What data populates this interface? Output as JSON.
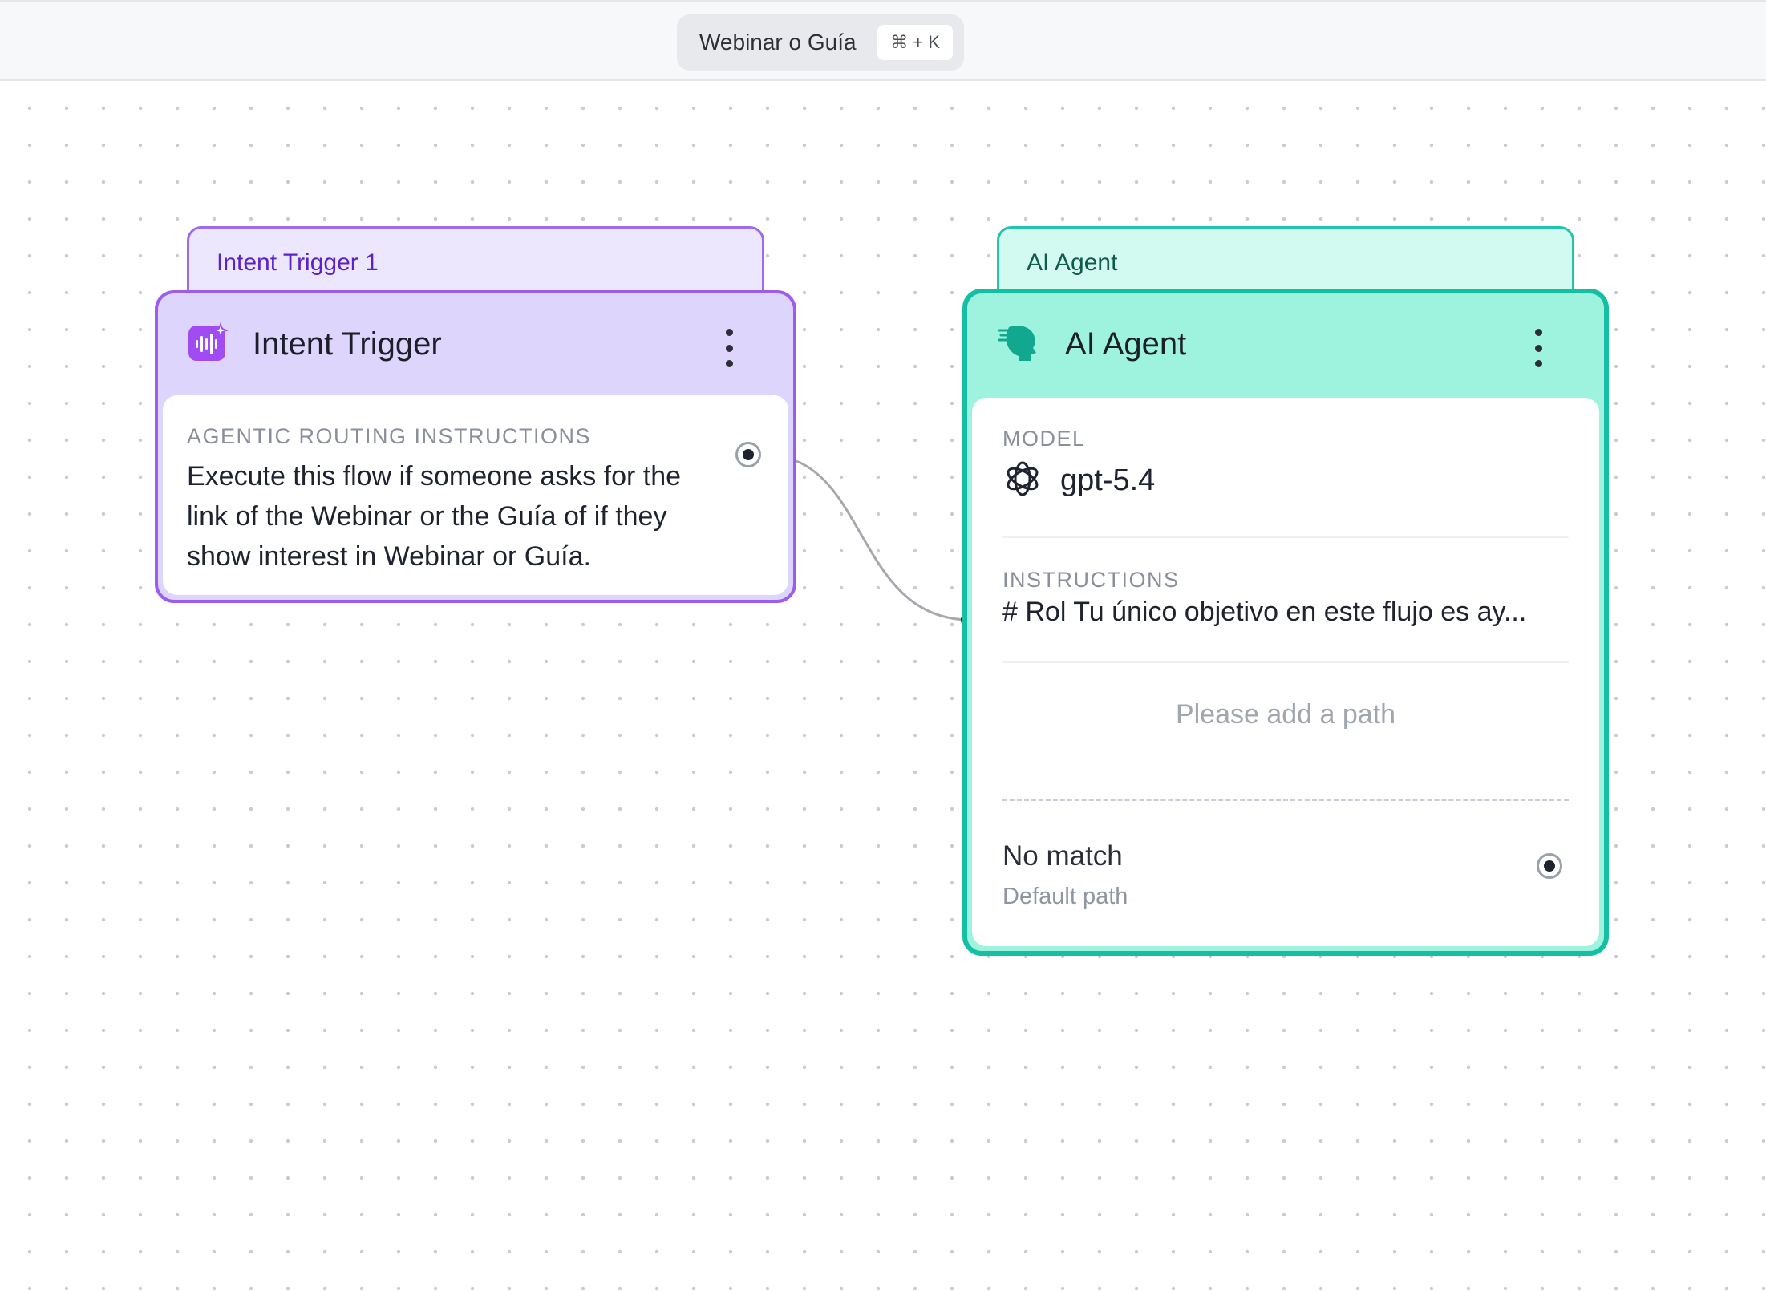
{
  "topbar": {
    "flow_name": "Webinar o Guía",
    "shortcut": "⌘ + K"
  },
  "trigger_node": {
    "tab_label": "Intent Trigger 1",
    "title": "Intent Trigger",
    "icon": "audio-sparkle-icon",
    "section_label": "AGENTIC ROUTING INSTRUCTIONS",
    "instructions": "Execute this flow if someone asks for the link of the Webinar or the Guía of if they show interest in Webinar or Guía.",
    "accent_color": "#9b5cf0"
  },
  "agent_node": {
    "tab_label": "AI Agent",
    "title": "AI Agent",
    "icon": "ai-head-icon",
    "model_label": "MODEL",
    "model_icon": "openai-logo-icon",
    "model_value": "gpt-5.4",
    "instructions_label": "INSTRUCTIONS",
    "instructions_value": "# Rol Tu único objetivo en este flujo es ay...",
    "paths_placeholder": "Please add a path",
    "no_match_title": "No match",
    "no_match_subtitle": "Default path",
    "accent_color": "#15bfa4"
  }
}
